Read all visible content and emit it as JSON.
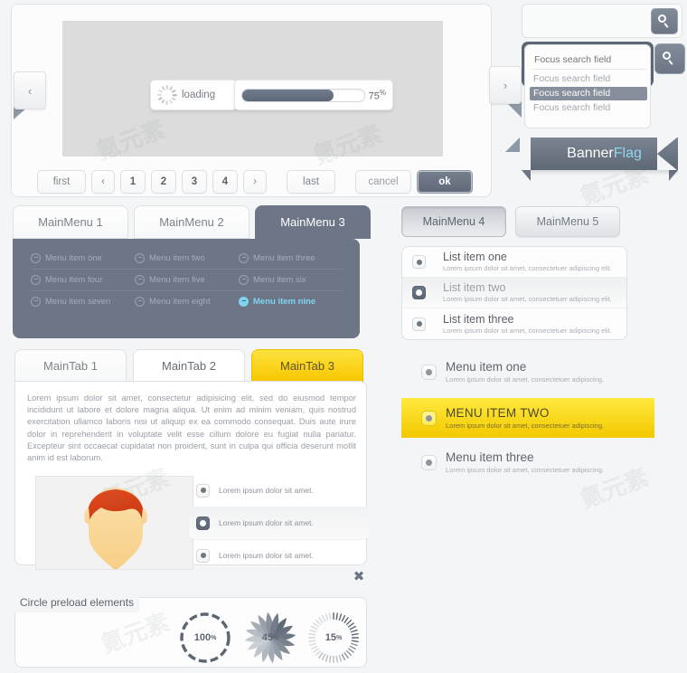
{
  "theme": {
    "page_bg": "#f4f5f6",
    "accent_dark": "#6d7686",
    "accent_cyan": "#7fd4ef",
    "accent_yellow": "#f7c800",
    "text_gray": "#9aa0a8"
  },
  "slider": {
    "prev_label": "‹",
    "next_label": "›",
    "loading": {
      "label": "loading",
      "icon": "spinner-icon"
    },
    "progress": {
      "value": 75,
      "value_label": "75",
      "unit": "%"
    }
  },
  "pagination": {
    "first": "first",
    "prev": "‹",
    "pages": [
      "1",
      "2",
      "3",
      "4"
    ],
    "next": "›",
    "last": "last",
    "cancel": "cancel",
    "ok": "ok"
  },
  "search": {
    "simple": {
      "value": "",
      "placeholder": "",
      "icon": "search-icon"
    },
    "focused": {
      "placeholder": "Focus search field",
      "value": "",
      "icon": "search-icon",
      "suggestions": [
        {
          "label": "Focus search field",
          "highlighted": false
        },
        {
          "label": "Focus search field",
          "highlighted": true
        },
        {
          "label": "Focus search field",
          "highlighted": false
        }
      ]
    }
  },
  "banner": {
    "part_one": "Banner",
    "part_two": "Flag"
  },
  "main_menu": {
    "tabs": [
      {
        "label": "MainMenu 1",
        "active": false
      },
      {
        "label": "MainMenu 2",
        "active": false
      },
      {
        "label": "MainMenu 3",
        "active": true
      }
    ],
    "items": [
      {
        "label": "Menu item  one",
        "highlighted": false
      },
      {
        "label": "Menu item  two",
        "highlighted": false
      },
      {
        "label": "Menu item  three",
        "highlighted": false
      },
      {
        "label": "Menu item  four",
        "highlighted": false
      },
      {
        "label": "Menu item  five",
        "highlighted": false
      },
      {
        "label": "Menu item  six",
        "highlighted": false
      },
      {
        "label": "Menu item  seven",
        "highlighted": false
      },
      {
        "label": "Menu item  eight",
        "highlighted": false
      },
      {
        "label": "Menu item  nine",
        "highlighted": true
      }
    ]
  },
  "main_tab": {
    "tabs": [
      {
        "label": "MainTab 1",
        "state": "normal"
      },
      {
        "label": "MainTab 2",
        "state": "active"
      },
      {
        "label": "MainTab 3",
        "state": "yellow"
      }
    ],
    "body_text": "Lorem ipsum dolor sit amet, consectetur adipisicing elit, sed do eiusmod tempor incididunt ut labore et dolore magna aliqua. Ut enim ad minim veniam, quis nostrud exercitation ullamco laboris nisi ut aliquip ex ea commodo consequat. Duis aute irure dolor in reprehenderit in voluptate velit esse cillum dolore eu fugiat nulla pariatur. Excepteur sint occaecat cupidatat non proident, sunt in culpa qui officia deserunt mollit anim id est laborum.",
    "avatar_alt": "user-avatar",
    "radio_options": [
      {
        "label": "Lorem ipsum dolor sit amet.",
        "selected": false
      },
      {
        "label": "Lorem ipsum dolor sit amet.",
        "selected": true
      },
      {
        "label": "Lorem ipsum dolor sit amet.",
        "selected": false
      }
    ],
    "close_label": "✖"
  },
  "circle_preload": {
    "title": "Circle preload elements",
    "circles": [
      {
        "value": 100,
        "value_label": "100",
        "unit": "%",
        "style": "dashed"
      },
      {
        "value": 45,
        "value_label": "45",
        "unit": "%",
        "style": "blades"
      },
      {
        "value": 15,
        "value_label": "15",
        "unit": "%",
        "style": "ticks"
      }
    ]
  },
  "side_menu": {
    "buttons": [
      {
        "label": "MainMenu 4",
        "pressed": true
      },
      {
        "label": "MainMenu 5",
        "pressed": false
      }
    ],
    "list_items": [
      {
        "title": "List item one",
        "subtitle": "Lorem ipsum dolor sit amet, consectetuer adipiscing elit.",
        "selected": false
      },
      {
        "title": "List item two",
        "subtitle": "Lorem ipsum dolor sit amet, consectetuer adipiscing elit.",
        "selected": true
      },
      {
        "title": "List item three",
        "subtitle": "Lorem ipsum dolor sit amet, consectetuer adipiscing elit.",
        "selected": false
      }
    ],
    "menu_rows": [
      {
        "title": "Menu item one",
        "subtitle": "Lorem ipsum dolor sit amet, consectetuer adipiscing.",
        "highlighted": false
      },
      {
        "title": "MENU ITEM TWO",
        "subtitle": "Lorem ipsum dolor sit amet, consectetuer adipiscing.",
        "highlighted": true
      },
      {
        "title": "Menu item three",
        "subtitle": "Lorem ipsum dolor sit amet, consectetuer adipiscing.",
        "highlighted": false
      }
    ]
  },
  "watermarks": [
    "氪元素",
    "氪元素",
    "氪元素",
    "氪元素",
    "氪元素",
    "氪元素"
  ]
}
